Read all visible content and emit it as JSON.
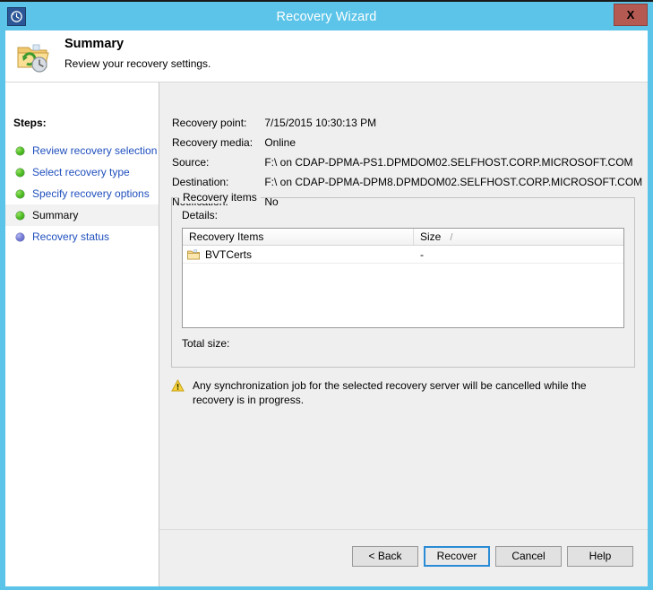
{
  "window": {
    "title": "Recovery Wizard",
    "titlebar_icon": "recovery-clock-icon",
    "close_label": "X",
    "accent_color": "#5bc4e8",
    "close_color": "#b55a52"
  },
  "header": {
    "icon": "folder-history-icon",
    "title": "Summary",
    "subtitle": "Review your recovery settings."
  },
  "sidebar": {
    "heading": "Steps:",
    "items": [
      {
        "label": "Review recovery selection",
        "state": "done",
        "current": false
      },
      {
        "label": "Select recovery type",
        "state": "done",
        "current": false
      },
      {
        "label": "Specify recovery options",
        "state": "done",
        "current": false
      },
      {
        "label": "Summary",
        "state": "done",
        "current": true
      },
      {
        "label": "Recovery status",
        "state": "pending",
        "current": false
      }
    ]
  },
  "summary": {
    "fields": [
      {
        "label": "Recovery point:",
        "value": "7/15/2015 10:30:13 PM"
      },
      {
        "label": "Recovery media:",
        "value": "Online"
      },
      {
        "label": "Source:",
        "value": "F:\\ on CDAP-DPMA-PS1.DPMDOM02.SELFHOST.CORP.MICROSOFT.COM"
      },
      {
        "label": "Destination:",
        "value": "F:\\ on CDAP-DPMA-DPM8.DPMDOM02.SELFHOST.CORP.MICROSOFT.COM"
      },
      {
        "label": "Notification:",
        "value": "No"
      }
    ]
  },
  "recovery_items": {
    "group_title": "Recovery items",
    "details_label": "Details:",
    "columns": [
      "Recovery Items",
      "Size"
    ],
    "sort_indicator": "/",
    "rows": [
      {
        "name": "BVTCerts",
        "size": "-",
        "icon": "folder-icon"
      }
    ],
    "total_size_label": "Total size:",
    "total_size_value": ""
  },
  "warning": {
    "icon": "warning-triangle-icon",
    "text": "Any synchronization job for the selected recovery server will be cancelled while the recovery is in progress."
  },
  "footer": {
    "buttons": [
      {
        "id": "back",
        "label": "< Back",
        "default": false
      },
      {
        "id": "recover",
        "label": "Recover",
        "default": true
      },
      {
        "id": "cancel",
        "label": "Cancel",
        "default": false
      },
      {
        "id": "help",
        "label": "Help",
        "default": false
      }
    ]
  }
}
